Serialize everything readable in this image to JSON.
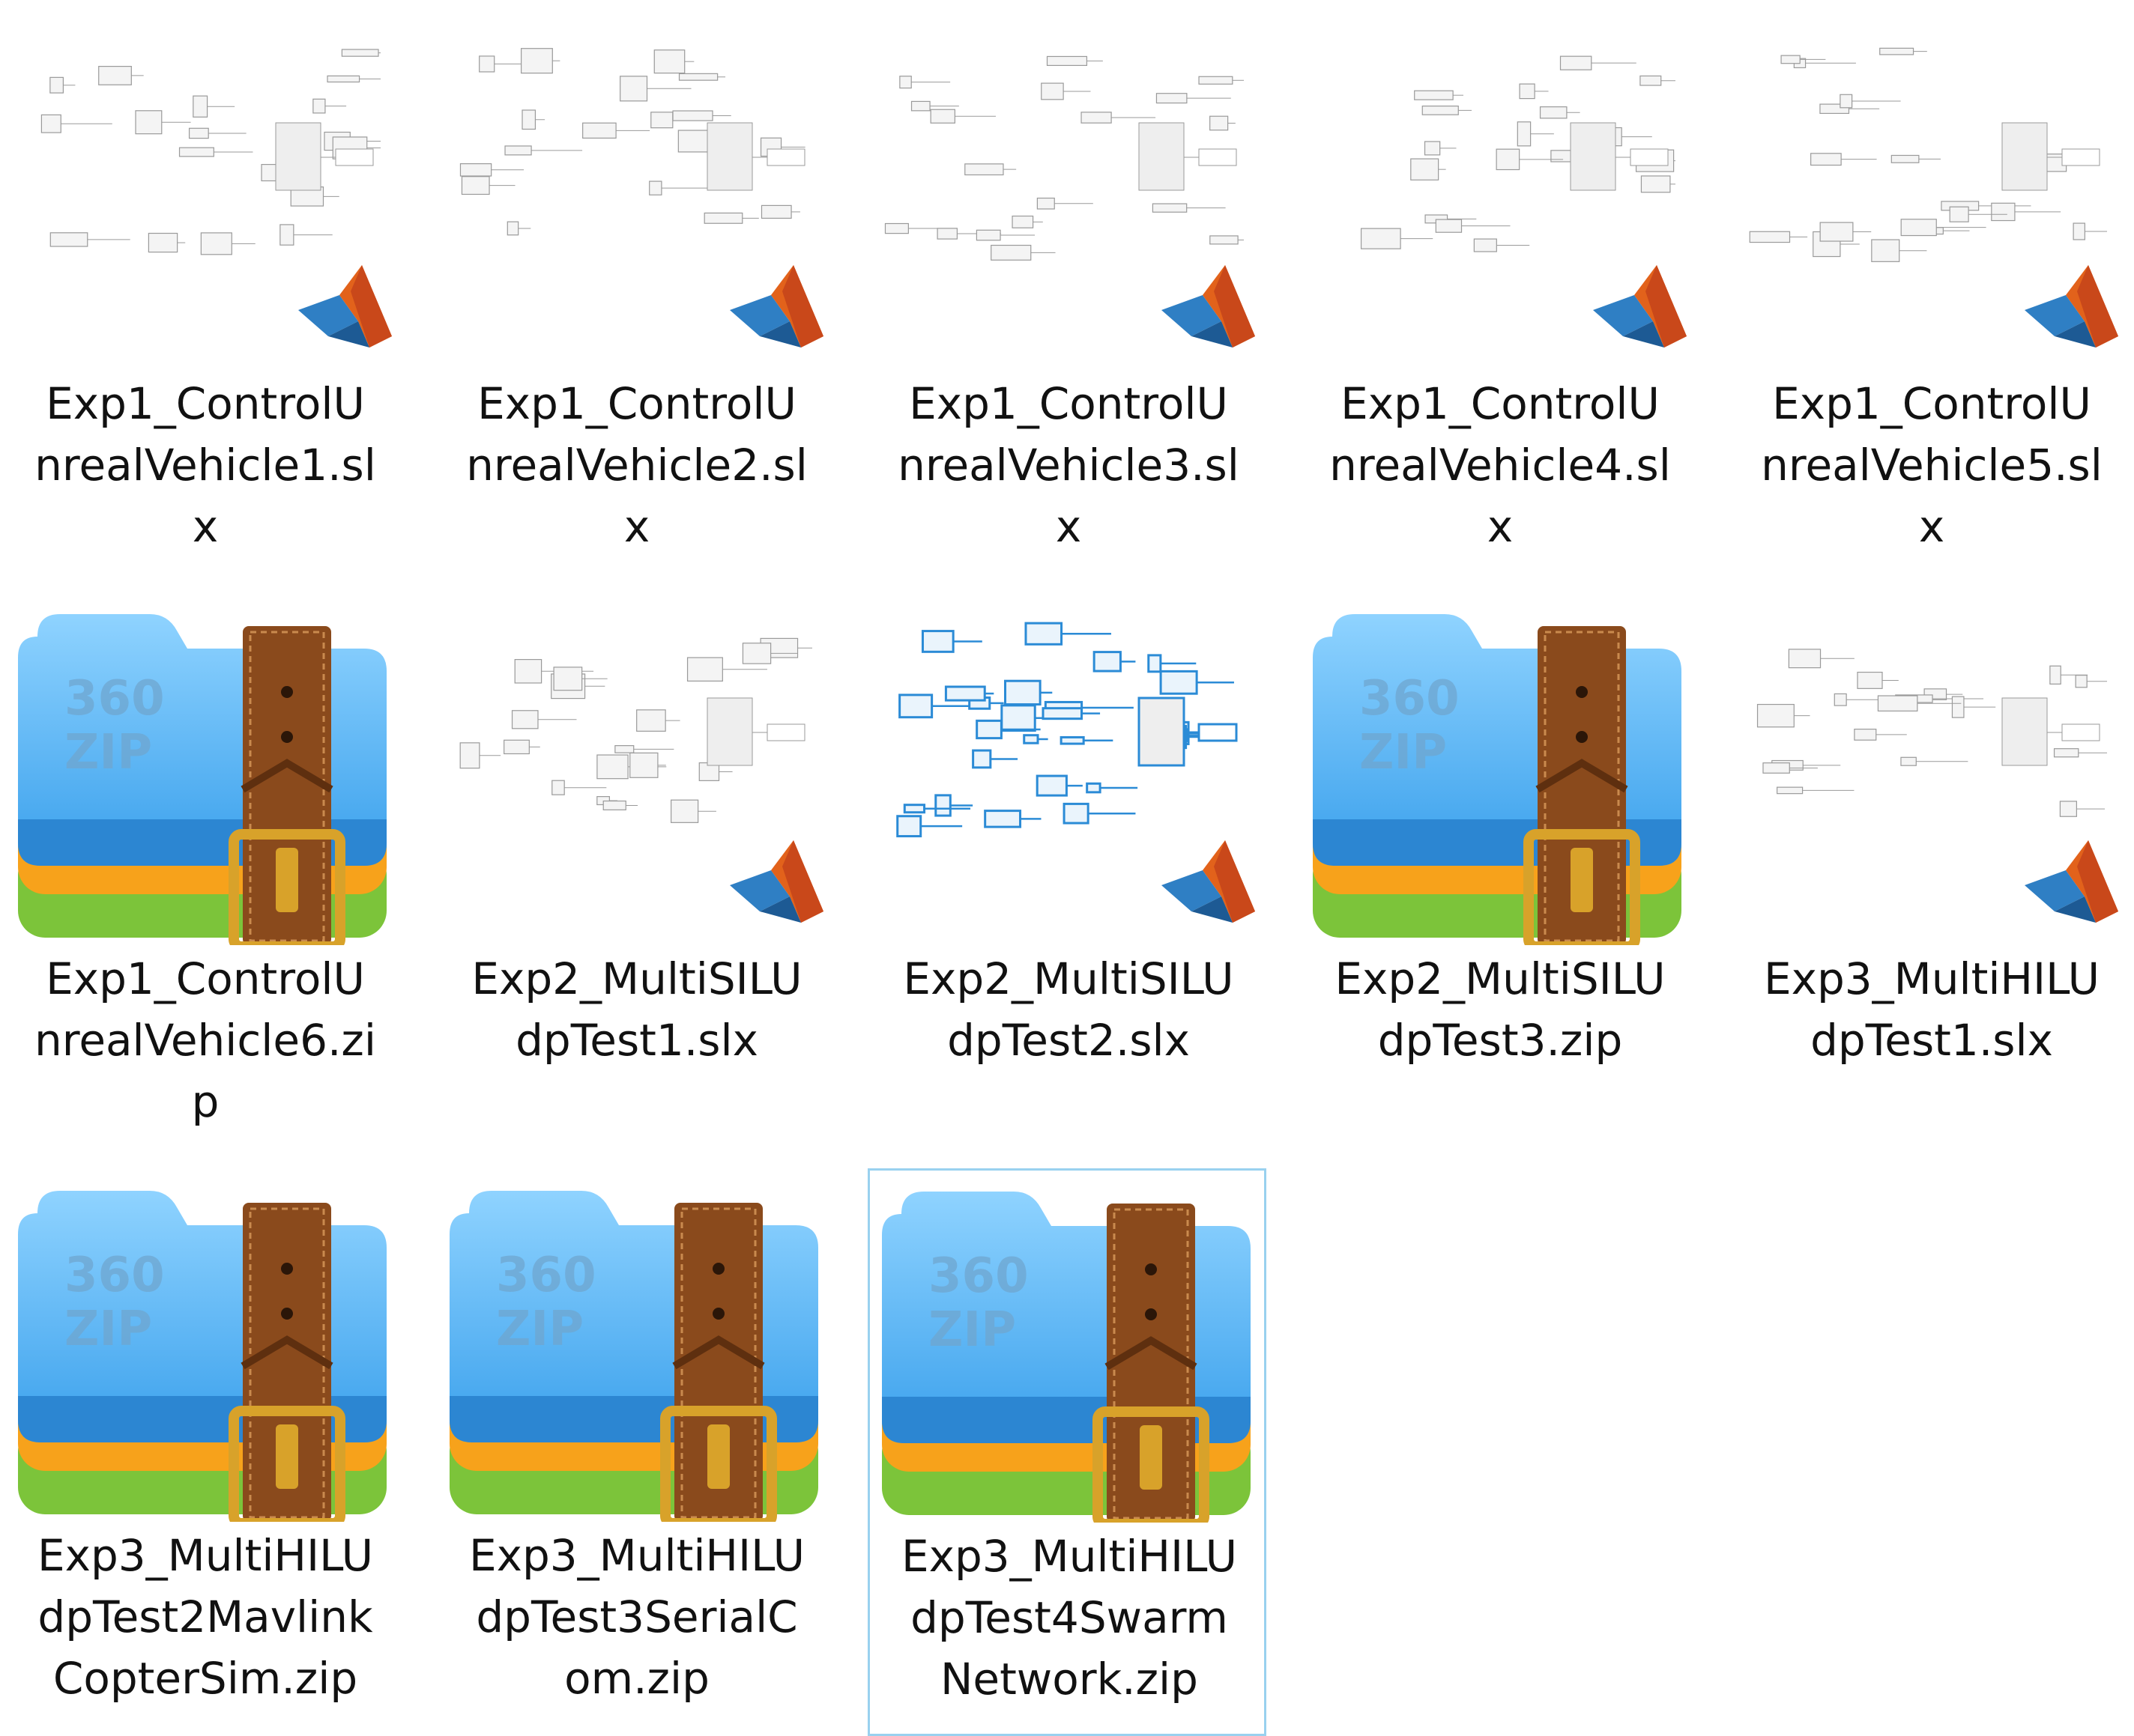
{
  "files": [
    {
      "name": "Exp1_ControlUnrealVehicle1.slx",
      "lines": [
        "Exp1_ControlU",
        "nrealVehicle1.sl",
        "x"
      ],
      "type": "slx",
      "icon": "simulink-model-thumbnail-icon"
    },
    {
      "name": "Exp1_ControlUnrealVehicle2.slx",
      "lines": [
        "Exp1_ControlU",
        "nrealVehicle2.sl",
        "x"
      ],
      "type": "slx",
      "icon": "simulink-model-thumbnail-icon"
    },
    {
      "name": "Exp1_ControlUnrealVehicle3.slx",
      "lines": [
        "Exp1_ControlU",
        "nrealVehicle3.sl",
        "x"
      ],
      "type": "slx",
      "icon": "simulink-model-thumbnail-icon"
    },
    {
      "name": "Exp1_ControlUnrealVehicle4.slx",
      "lines": [
        "Exp1_ControlU",
        "nrealVehicle4.sl",
        "x"
      ],
      "type": "slx",
      "icon": "simulink-model-thumbnail-icon"
    },
    {
      "name": "Exp1_ControlUnrealVehicle5.slx",
      "lines": [
        "Exp1_ControlU",
        "nrealVehicle5.sl",
        "x"
      ],
      "type": "slx",
      "icon": "simulink-model-thumbnail-icon"
    },
    {
      "name": "Exp1_ControlUnrealVehicle6.zip",
      "lines": [
        "Exp1_ControlU",
        "nrealVehicle6.zi",
        "p"
      ],
      "type": "zip",
      "icon": "360zip-archive-icon"
    },
    {
      "name": "Exp2_MultiSILUdpTest1.slx",
      "lines": [
        "Exp2_MultiSILU",
        "dpTest1.slx"
      ],
      "type": "slx",
      "icon": "simulink-model-thumbnail-icon"
    },
    {
      "name": "Exp2_MultiSILUdpTest2.slx",
      "lines": [
        "Exp2_MultiSILU",
        "dpTest2.slx"
      ],
      "type": "slx-blue",
      "icon": "simulink-model-thumbnail-icon"
    },
    {
      "name": "Exp2_MultiSILUdpTest3.zip",
      "lines": [
        "Exp2_MultiSILU",
        "dpTest3.zip"
      ],
      "type": "zip",
      "icon": "360zip-archive-icon"
    },
    {
      "name": "Exp3_MultiHILUdpTest1.slx",
      "lines": [
        "Exp3_MultiHILU",
        "dpTest1.slx"
      ],
      "type": "slx",
      "icon": "simulink-model-thumbnail-icon"
    },
    {
      "name": "Exp3_MultiHILUdpTest2MavlinkCopterSim.zip",
      "lines": [
        "Exp3_MultiHILU",
        "dpTest2Mavlink",
        "CopterSim.zip"
      ],
      "type": "zip",
      "icon": "360zip-archive-icon"
    },
    {
      "name": "Exp3_MultiHILUdpTest3SerialCom.zip",
      "lines": [
        "Exp3_MultiHILU",
        "dpTest3SerialC",
        "om.zip"
      ],
      "type": "zip",
      "icon": "360zip-archive-icon"
    },
    {
      "name": "Exp3_MultiHILUdpTest4SwarmNetwork.zip",
      "lines": [
        "Exp3_MultiHILU",
        "dpTest4Swarm",
        "Network.zip"
      ],
      "type": "zip",
      "icon": "360zip-archive-icon",
      "selected": true
    }
  ],
  "zip_badge": {
    "line1": "360",
    "line2": "ZIP"
  },
  "colors": {
    "selection_border": "#99d1ef",
    "zip_blue": "#3aa0ec",
    "zip_orange": "#f7a21b",
    "zip_green": "#7cc43a",
    "strap_brown": "#8a4a1c",
    "buckle_gold": "#d8a22a",
    "matlab_orange": "#e2621b",
    "matlab_blue": "#2f7fc4"
  }
}
